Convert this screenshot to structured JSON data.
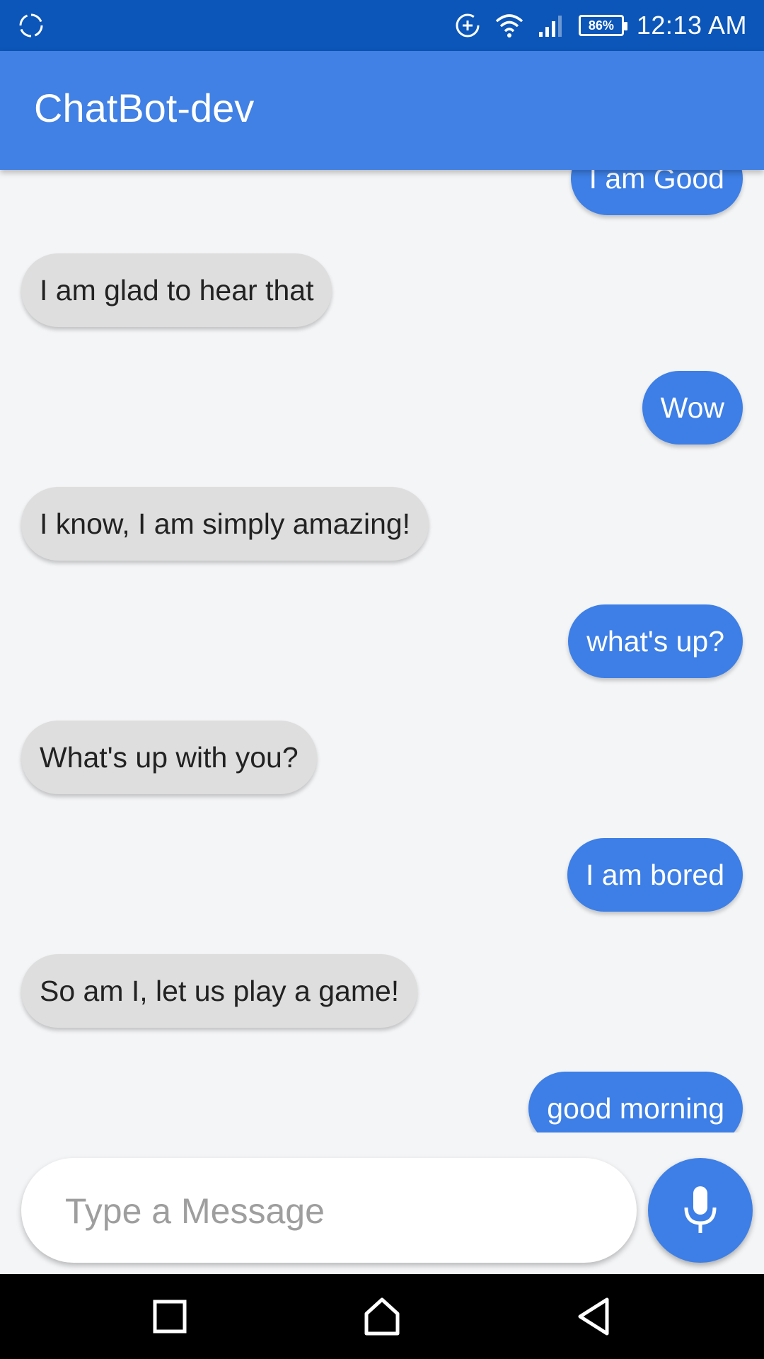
{
  "status_bar": {
    "battery_percent": "86%",
    "time": "12:13 AM"
  },
  "app_bar": {
    "title": "ChatBot-dev"
  },
  "messages": [
    {
      "sender": "user",
      "text": "I am Good"
    },
    {
      "sender": "bot",
      "text": "I am glad to hear that"
    },
    {
      "sender": "user",
      "text": "Wow"
    },
    {
      "sender": "bot",
      "text": "I know, I am simply amazing!"
    },
    {
      "sender": "user",
      "text": "what's up?"
    },
    {
      "sender": "bot",
      "text": "What's up with you?"
    },
    {
      "sender": "user",
      "text": "I am bored"
    },
    {
      "sender": "bot",
      "text": "So am I, let us play a game!"
    },
    {
      "sender": "user",
      "text": "good morning"
    }
  ],
  "composer": {
    "placeholder": "Type a Message",
    "value": ""
  },
  "icons": {
    "status_left": "sync-icon",
    "data_saver": "data-saver-icon",
    "wifi": "wifi-icon",
    "signal": "signal-icon",
    "battery": "battery-icon",
    "mic": "mic-icon",
    "nav_recents": "recents-icon",
    "nav_home": "home-icon",
    "nav_back": "back-icon"
  },
  "colors": {
    "status_bar": "#0b56b8",
    "app_bar": "#4180e4",
    "user_bubble": "#3d7fe6",
    "bot_bubble": "#dedede",
    "background": "#f4f5f7"
  }
}
